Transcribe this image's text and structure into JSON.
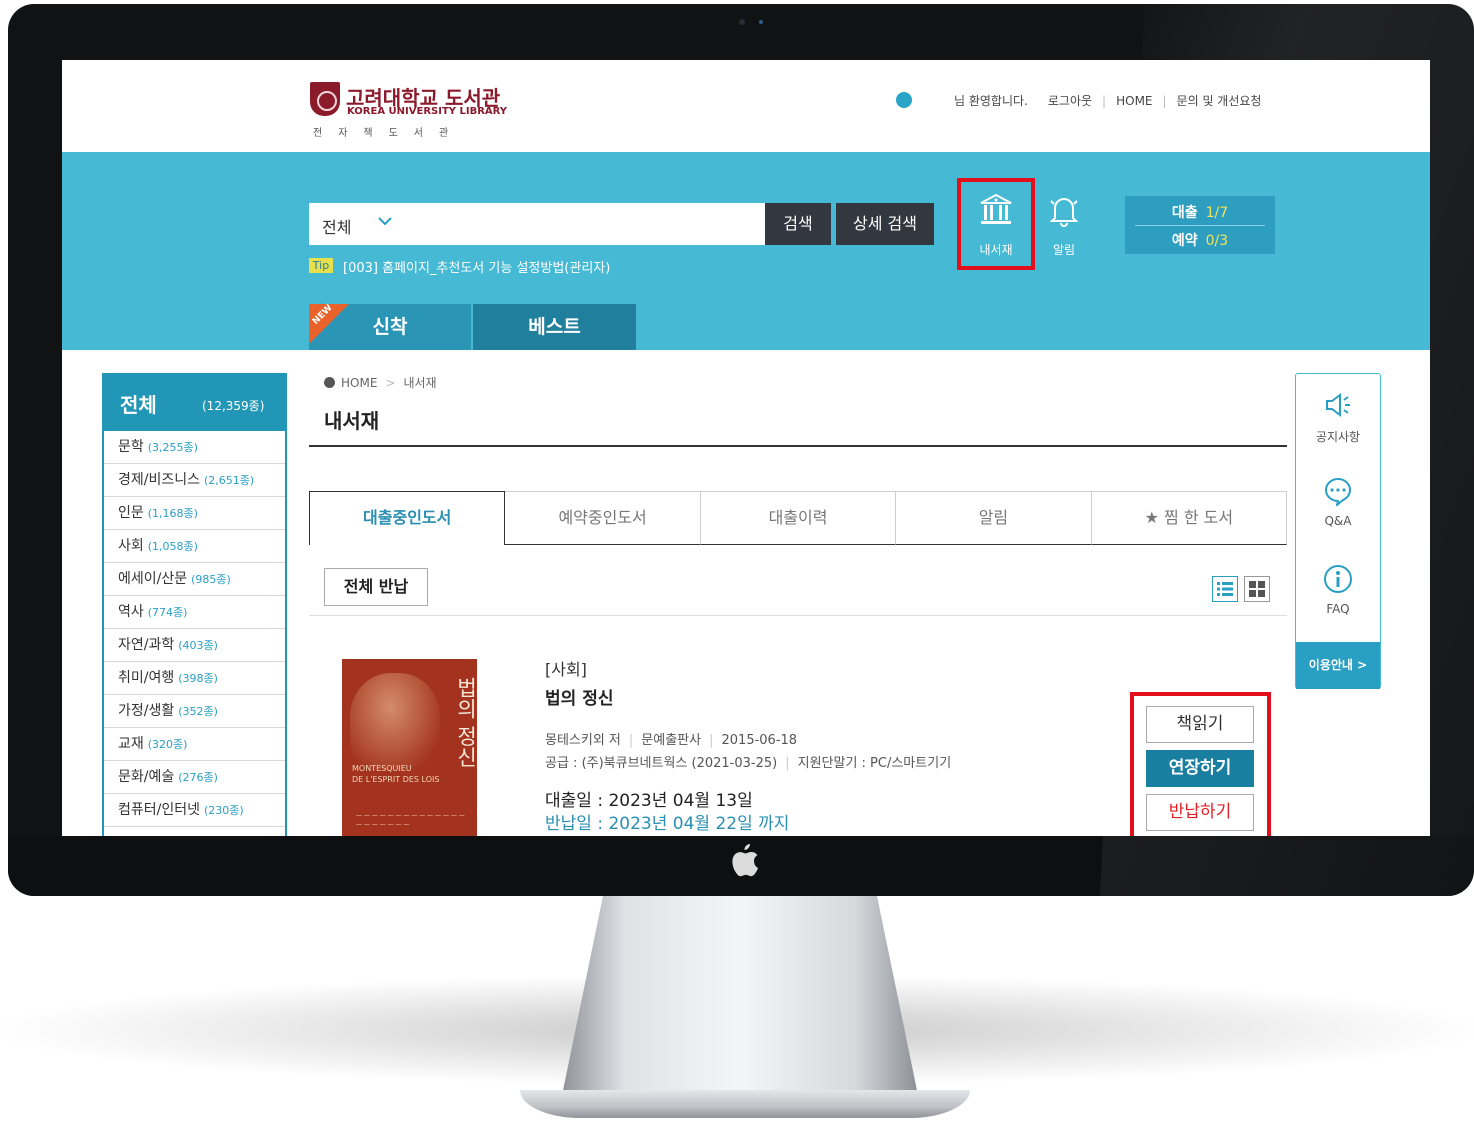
{
  "logo": {
    "title": "고려대학교 도서관",
    "subtitle": "KOREA UNIVERSITY LIBRARY",
    "tagline": "전자책도서관"
  },
  "header": {
    "welcome": "님 환영합니다.",
    "logout": "로그아웃",
    "home": "HOME",
    "inquiry": "문의 및 개선요청"
  },
  "search": {
    "scope": "전체",
    "search_button": "검색",
    "advanced_button": "상세 검색",
    "tip_badge": "Tip",
    "tip_text": "[003] 홈페이지_추천도서 기능 설정방법(관리자)"
  },
  "quick": {
    "shelf_label": "내서재",
    "alarm_label": "알림"
  },
  "status": {
    "loan_label": "대출",
    "loan_value": "1/7",
    "reserve_label": "예약",
    "reserve_value": "0/3"
  },
  "main_tabs": {
    "new_badge": "NEW",
    "new_label": "신착",
    "best_label": "베스트"
  },
  "categories": {
    "all_label": "전체",
    "all_count": "(12,359종)",
    "items": [
      {
        "label": "문학",
        "count": "(3,255종)"
      },
      {
        "label": "경제/비즈니스",
        "count": "(2,651종)"
      },
      {
        "label": "인문",
        "count": "(1,168종)"
      },
      {
        "label": "사회",
        "count": "(1,058종)"
      },
      {
        "label": "에세이/산문",
        "count": "(985종)"
      },
      {
        "label": "역사",
        "count": "(774종)"
      },
      {
        "label": "자연/과학",
        "count": "(403종)"
      },
      {
        "label": "취미/여행",
        "count": "(398종)"
      },
      {
        "label": "가정/생활",
        "count": "(352종)"
      },
      {
        "label": "교재",
        "count": "(320종)"
      },
      {
        "label": "문화/예술",
        "count": "(276종)"
      },
      {
        "label": "컴퓨터/인터넷",
        "count": "(230종)"
      }
    ]
  },
  "side": {
    "notice": "공지사항",
    "qa": "Q&A",
    "faq": "FAQ",
    "guide": "이용안내 >"
  },
  "breadcrumb": {
    "home": "HOME",
    "current": "내서재"
  },
  "page": {
    "title": "내서재",
    "tabs": [
      "대출중인도서",
      "예약중인도서",
      "대출이력",
      "알림",
      "★ 찜 한 도서"
    ],
    "return_all": "전체 반납"
  },
  "book": {
    "category": "[사회]",
    "title": "법의 정신",
    "author": "몽테스키외 저",
    "publisher": "문예출판사",
    "pub_date": "2015-06-18",
    "supply": "공급 : (주)북큐브네트웍스 (2021-03-25)",
    "device": "지원단말기 : PC/스마트기기",
    "loan_date": "대출일 : 2023년 04월 13일",
    "due_date": "반납일 : 2023년 04월 22일 까지",
    "cover_title": "법의 정신",
    "cover_fr_1": "MONTESQUIEU",
    "cover_fr_2": "DE L'ESPRIT DES LOIS",
    "actions": {
      "read": "책읽기",
      "renew": "연장하기",
      "return": "반납하기"
    }
  },
  "colors": {
    "band": "#46b9d5",
    "accent": "#2a9fc4",
    "brand": "#8b1a2b",
    "highlight": "#e3101c",
    "renew": "#1a7ea0"
  }
}
